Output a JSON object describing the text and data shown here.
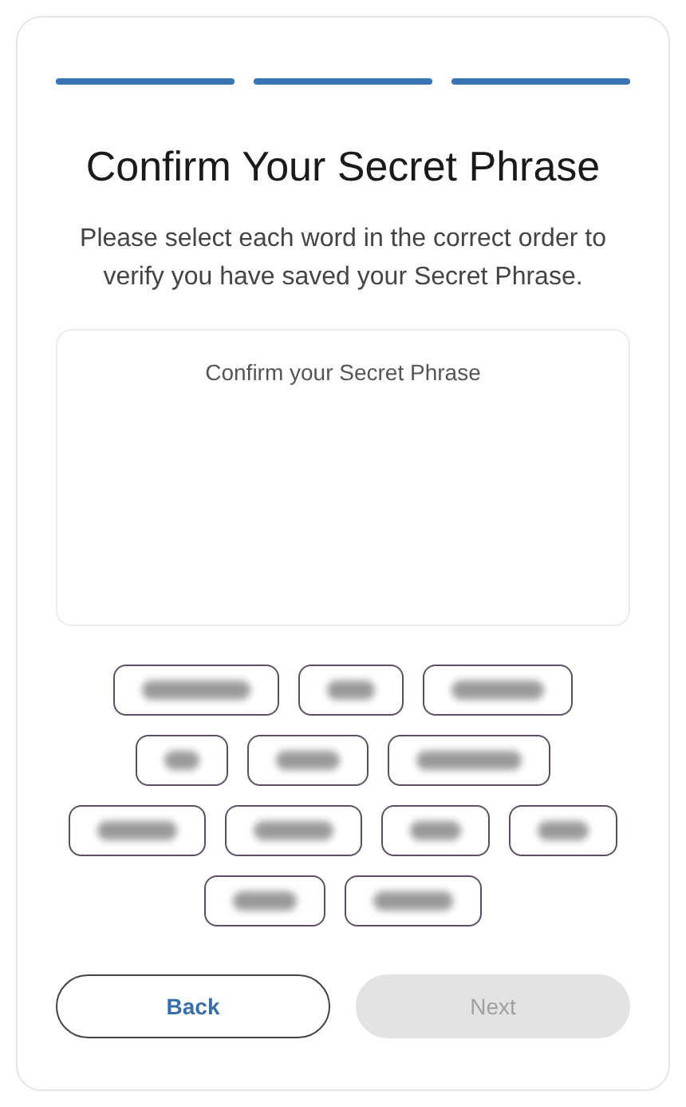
{
  "steps": [
    {
      "done": true
    },
    {
      "done": true
    },
    {
      "done": true
    }
  ],
  "title": "Confirm Your Secret Phrase",
  "description": "Please select each word in the correct order to verify you have saved your Secret Phrase.",
  "phrase_box": {
    "placeholder": "Confirm your Secret Phrase"
  },
  "word_chips": [
    {
      "kind": "blurred"
    },
    {
      "kind": "blurred"
    },
    {
      "kind": "blurred"
    },
    {
      "kind": "blurred"
    },
    {
      "kind": "blurred"
    },
    {
      "kind": "blurred"
    },
    {
      "kind": "blurred"
    },
    {
      "kind": "blurred"
    },
    {
      "kind": "blurred"
    },
    {
      "kind": "blurred"
    },
    {
      "kind": "blurred"
    },
    {
      "kind": "blurred"
    }
  ],
  "buttons": [
    {
      "label": "Back",
      "disabled": false
    },
    {
      "label": "Next",
      "disabled": true
    }
  ]
}
